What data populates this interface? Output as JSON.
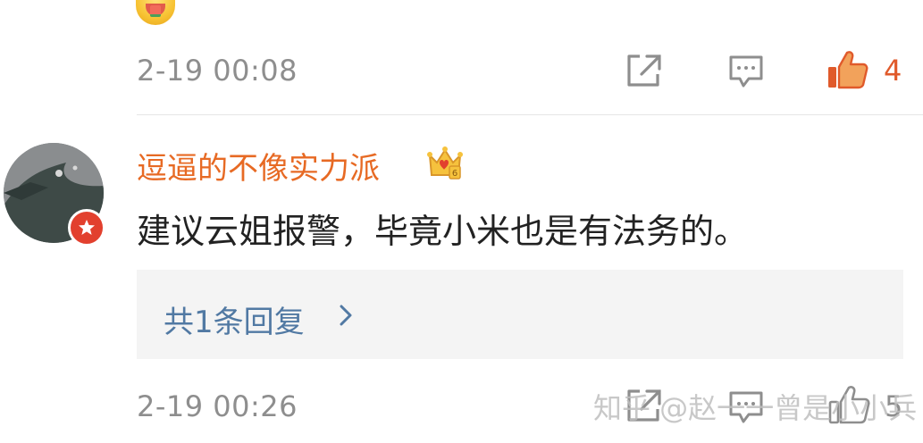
{
  "comment1": {
    "timestamp": "2-19 00:08",
    "like_count": "4",
    "emoji_icon": "watermelon-eating-face-emoji"
  },
  "comment2": {
    "username": "逗逼的不像实力派",
    "text": "建议云姐报警，毕竟小米也是有法务的。",
    "reply_summary": "共1条回复",
    "timestamp": "2-19 00:26",
    "like_count": "5"
  },
  "watermark": "知乎 @赵一一曾是小小兵",
  "colors": {
    "username": "#e76a24",
    "like_active": "#e05a2b",
    "reply_link": "#5179a3",
    "timestamp": "#8e8e8e",
    "badge": "#e2402e"
  }
}
